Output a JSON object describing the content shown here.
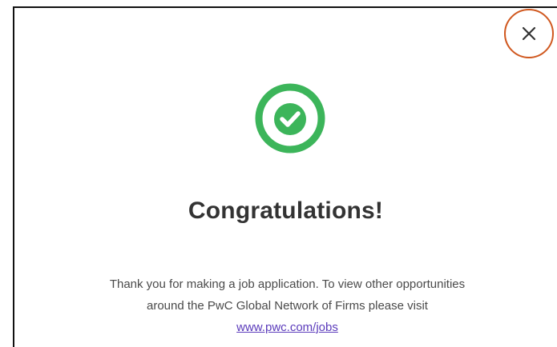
{
  "dialog": {
    "close_icon": "close-icon",
    "success_icon": "check-circle-icon",
    "accent_color": "#3cb55a",
    "close_ring_color": "#d0581f",
    "title": "Congratulations!",
    "message_line1": "Thank you for making a job application. To view other opportunities",
    "message_line2": "around the PwC Global Network of Firms please visit",
    "link_text": "www.pwc.com/jobs"
  }
}
